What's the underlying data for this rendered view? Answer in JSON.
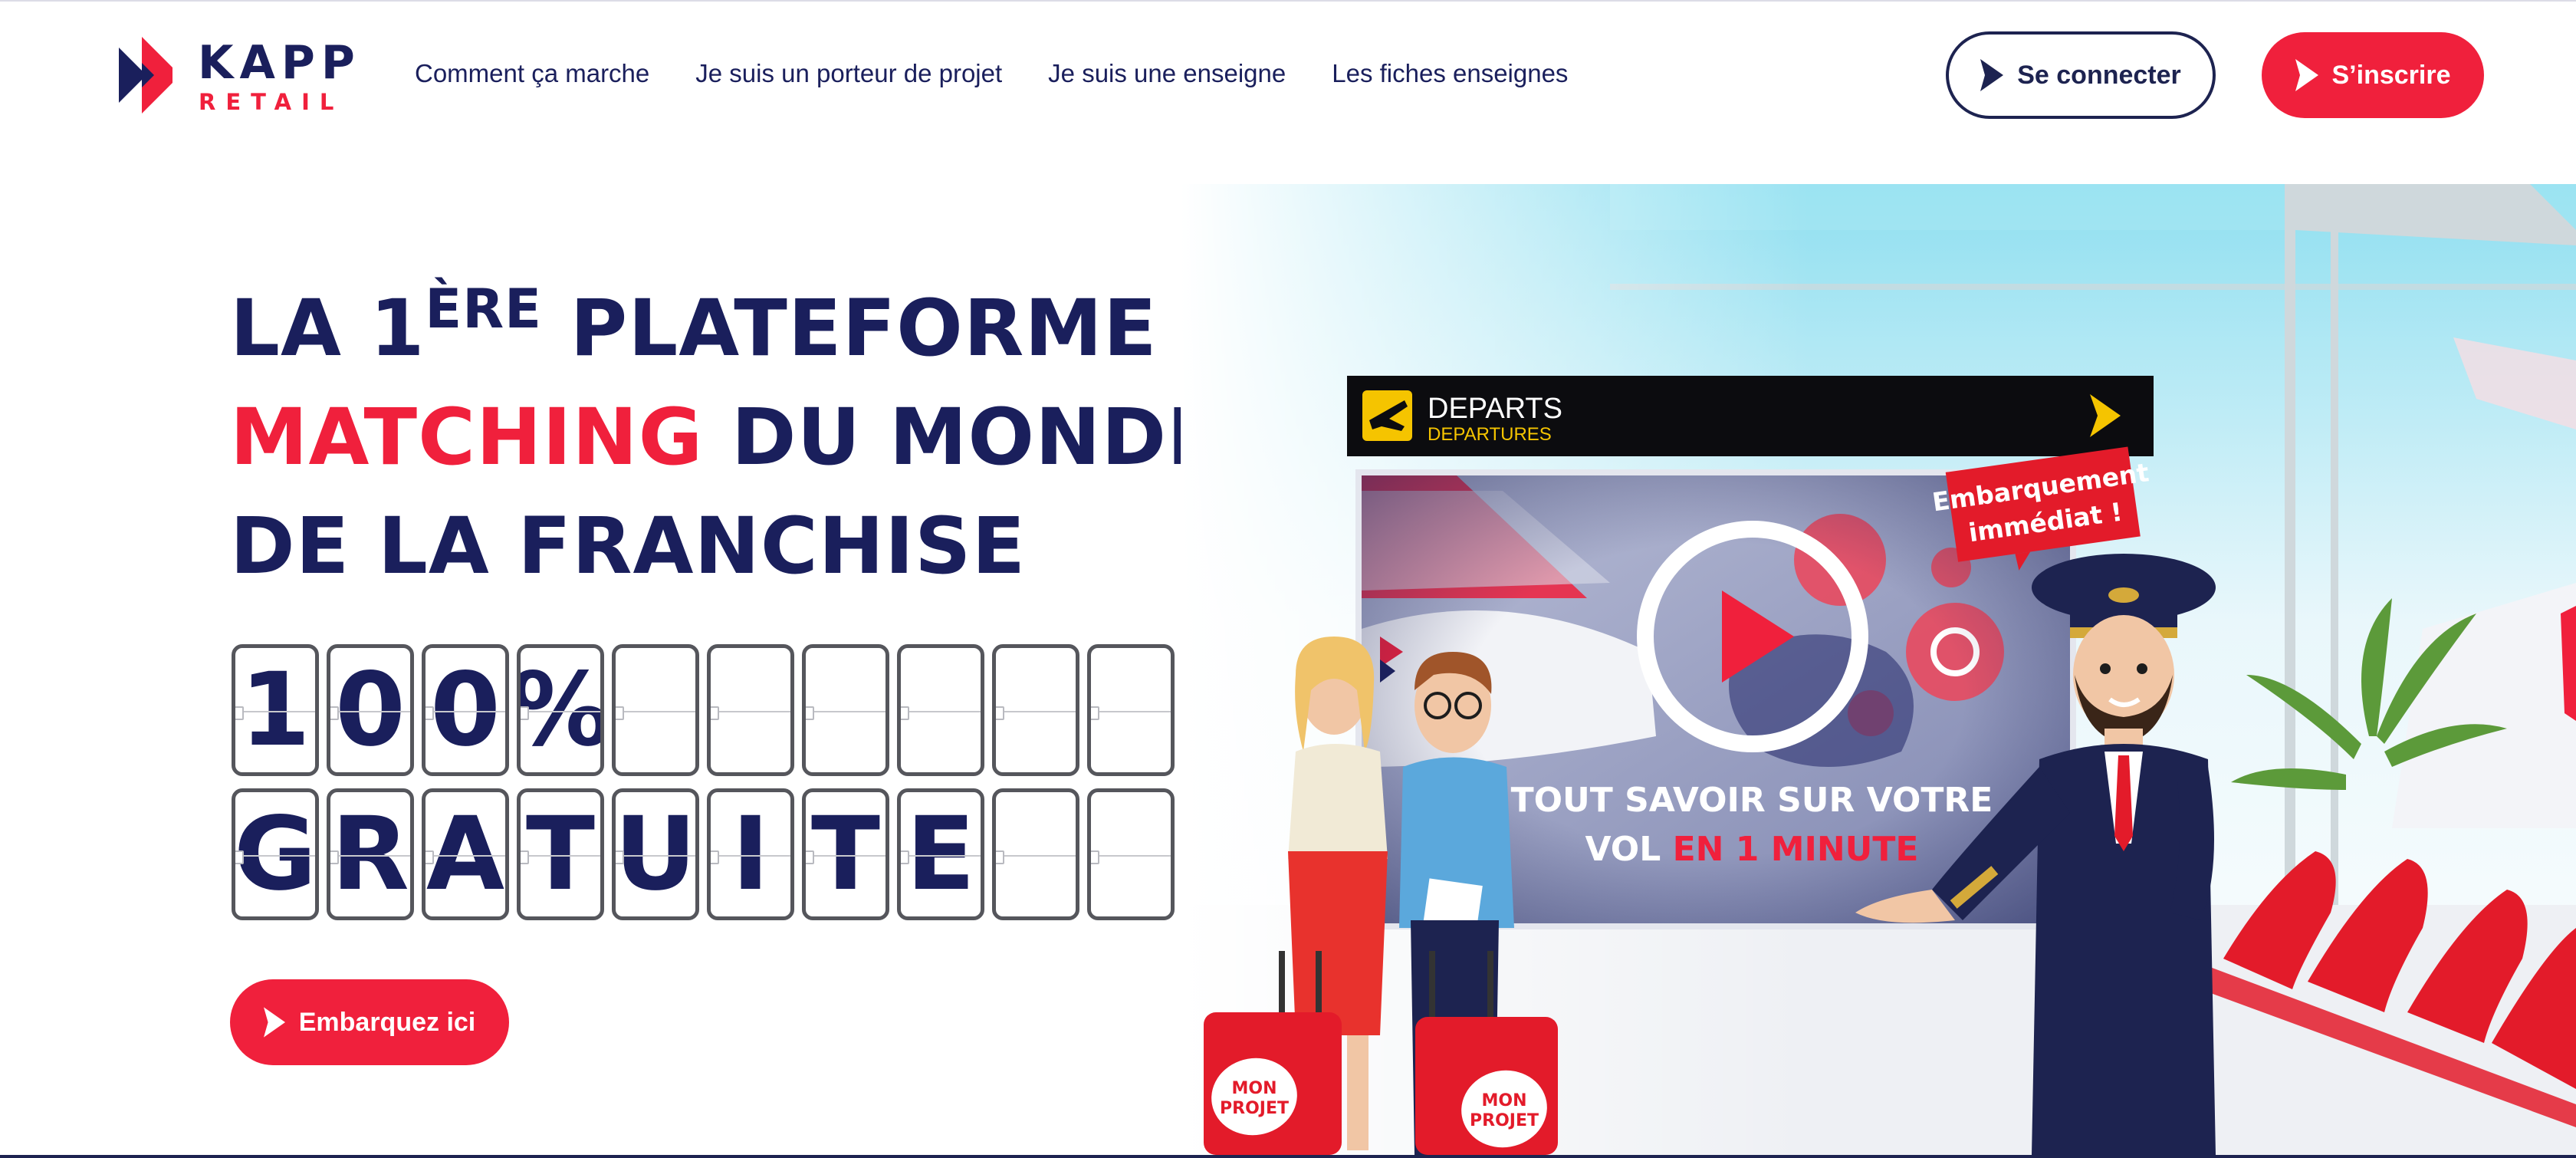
{
  "brand": {
    "name_top": "KAPP",
    "name_bottom": "RETAIL"
  },
  "nav": {
    "items": [
      {
        "label": "Comment ça marche"
      },
      {
        "label": "Je suis un porteur de projet"
      },
      {
        "label": "Je suis une enseigne"
      },
      {
        "label": "Les fiches enseignes"
      }
    ]
  },
  "auth": {
    "login_label": "Se connecter",
    "signup_label": "S’inscrire"
  },
  "hero": {
    "line1_a": "LA 1",
    "line1_sup": "ÈRE",
    "line1_b": " PLATEFORME DE",
    "line2_red": "MATCHING",
    "line2_rest": " DU MONDE ...",
    "line3": "DE LA FRANCHISE",
    "board_row1": [
      "1",
      "0",
      "0",
      "%",
      "",
      "",
      "",
      "",
      "",
      ""
    ],
    "board_row2": [
      "G",
      "R",
      "A",
      "T",
      "U",
      "I",
      "T",
      "E",
      "",
      ""
    ],
    "cta_label": "Embarquez ici"
  },
  "video": {
    "board_title": "DEPARTS",
    "board_subtitle": "DEPARTURES",
    "badge_line1": "Embarquement",
    "badge_line2": "immédiat !",
    "caption_line1": "TOUT SAVOIR SUR VOTRE",
    "caption_line2_a": "VOL ",
    "caption_line2_red": "EN 1 MINUTE",
    "suitcase_label_line1": "MON",
    "suitcase_label_line2": "PROJET"
  },
  "colors": {
    "navy": "#1a1f5c",
    "red": "#f0203c",
    "departures_yellow": "#f5c400"
  }
}
